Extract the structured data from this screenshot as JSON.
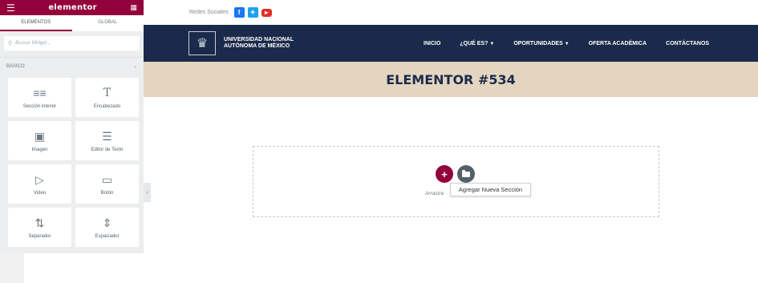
{
  "sidebar": {
    "logo": "elementor",
    "tabs": [
      "ELEMENTOS",
      "GLOBAL"
    ],
    "search_placeholder": "Buscar Widget...",
    "category": "BÁSICO",
    "widgets": [
      {
        "label": "Sección interior",
        "icon": "inner-section-icon"
      },
      {
        "label": "Encabezado",
        "icon": "heading-icon"
      },
      {
        "label": "Imagen",
        "icon": "image-icon"
      },
      {
        "label": "Editor de Texto",
        "icon": "text-editor-icon"
      },
      {
        "label": "Video",
        "icon": "video-icon"
      },
      {
        "label": "Botón",
        "icon": "button-icon"
      },
      {
        "label": "Separador",
        "icon": "divider-icon"
      },
      {
        "label": "Espaciador",
        "icon": "spacer-icon"
      }
    ]
  },
  "topbar": {
    "social_label": "Redes Sociales",
    "icons": [
      "facebook-icon",
      "twitter-icon",
      "youtube-icon"
    ],
    "colors": {
      "facebook": "#1877f2",
      "twitter": "#1da1f2",
      "youtube": "#e52d27"
    }
  },
  "navbar": {
    "org_line1": "UNIVERSIDAD NACIONAL",
    "org_line2": "AUTÓNOMA DE MÉXICO",
    "menu": [
      {
        "label": "INICIO",
        "dropdown": false
      },
      {
        "label": "¿QUÉ ES?",
        "dropdown": true
      },
      {
        "label": "OPORTUNIDADES",
        "dropdown": true
      },
      {
        "label": "OFERTA ACADÉMICA",
        "dropdown": false
      },
      {
        "label": "CONTÁCTANOS",
        "dropdown": false
      }
    ]
  },
  "page": {
    "title": "ELEMENTOR #534",
    "drag_text": "Arrastra",
    "tooltip": "Agregar Nueva Sección"
  },
  "colors": {
    "accent": "#93003c",
    "navy": "#1b2a4a",
    "title_band": "#e4d5c0"
  }
}
